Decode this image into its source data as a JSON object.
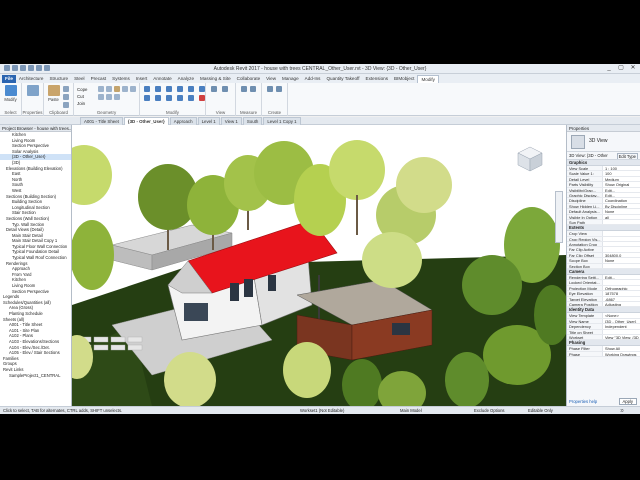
{
  "window": {
    "title": "Autodesk Revit 2017 - house with trees CENTRAL_Other_User.rvt - 3D View: {3D - Other_User}",
    "controls": [
      "_",
      "▢",
      "✕"
    ]
  },
  "ribbon_tabs": [
    "File",
    "Architecture",
    "Structure",
    "Steel",
    "Precast",
    "Systems",
    "Insert",
    "Annotate",
    "Analyze",
    "Massing & Site",
    "Collaborate",
    "View",
    "Manage",
    "Add-Ins",
    "Quantity Takeoff",
    "Extensions",
    "BIMobject",
    "Modify"
  ],
  "active_tab": "Modify",
  "ribbon_panels": {
    "select": {
      "label": "Select",
      "button": "Modify"
    },
    "properties": {
      "label": "Properties"
    },
    "clipboard": {
      "label": "Clipboard",
      "paste": "Paste"
    },
    "geometry": {
      "label": "Geometry",
      "cope": "Cope",
      "cut": "Cut",
      "join": "Join"
    },
    "modify": {
      "label": "Modify"
    },
    "view": {
      "label": "View"
    },
    "measure": {
      "label": "Measure"
    },
    "create": {
      "label": "Create"
    }
  },
  "view_tabs": [
    "A001 - Title Sheet",
    "{3D - Other_User}",
    "Approach",
    "Level 1",
    "View 1",
    "South",
    "Level 1 Copy 1"
  ],
  "active_view_tab": "{3D - Other_User}",
  "project_browser": {
    "title": "Project Browser - house with trees...",
    "items": [
      {
        "label": "Kitchen",
        "indent": 4
      },
      {
        "label": "Living Room",
        "indent": 4
      },
      {
        "label": "Section Perspective",
        "indent": 4
      },
      {
        "label": "Solar Analysis",
        "indent": 4
      },
      {
        "label": "{3D - Other_User}",
        "indent": 4,
        "selected": true
      },
      {
        "label": "{3D}",
        "indent": 4
      },
      {
        "label": "Elevations (Building Elevation)",
        "indent": 2
      },
      {
        "label": "East",
        "indent": 4
      },
      {
        "label": "North",
        "indent": 4
      },
      {
        "label": "South",
        "indent": 4
      },
      {
        "label": "West",
        "indent": 4
      },
      {
        "label": "Sections (Building Section)",
        "indent": 2
      },
      {
        "label": "Building Section",
        "indent": 4
      },
      {
        "label": "Longitudinal Section",
        "indent": 4
      },
      {
        "label": "Stair Section",
        "indent": 4
      },
      {
        "label": "Sections (Wall Section)",
        "indent": 2
      },
      {
        "label": "Typ. Wall Section",
        "indent": 4
      },
      {
        "label": "Detail Views (Detail)",
        "indent": 2
      },
      {
        "label": "Main Stair Detail",
        "indent": 4
      },
      {
        "label": "Main Stair Detail Copy 1",
        "indent": 4
      },
      {
        "label": "Typical Floor Wall Connection",
        "indent": 4
      },
      {
        "label": "Typical Foundation Detail",
        "indent": 4
      },
      {
        "label": "Typical Wall Roof Connection",
        "indent": 4
      },
      {
        "label": "Renderings",
        "indent": 2
      },
      {
        "label": "Approach",
        "indent": 4
      },
      {
        "label": "From Yard",
        "indent": 4
      },
      {
        "label": "Kitchen",
        "indent": 4
      },
      {
        "label": "Living Room",
        "indent": 4
      },
      {
        "label": "Section Perspective",
        "indent": 4
      },
      {
        "label": "Legends",
        "indent": 1
      },
      {
        "label": "Schedules/Quantities (all)",
        "indent": 1
      },
      {
        "label": "Area (Gross)",
        "indent": 3
      },
      {
        "label": "Planting Schedule",
        "indent": 3
      },
      {
        "label": "Sheets (all)",
        "indent": 1
      },
      {
        "label": "A001 - Title Sheet",
        "indent": 3
      },
      {
        "label": "A101 - Site Plan",
        "indent": 3
      },
      {
        "label": "A102 - Plans",
        "indent": 3
      },
      {
        "label": "A103 - Elevations/Sections",
        "indent": 3
      },
      {
        "label": "A104 - Elev./Sec./Det.",
        "indent": 3
      },
      {
        "label": "A105 - Elev./ Stair Sections",
        "indent": 3
      },
      {
        "label": "Families",
        "indent": 1
      },
      {
        "label": "Groups",
        "indent": 1
      },
      {
        "label": "Revit Links",
        "indent": 1
      },
      {
        "label": "SampleProject1_CENTRAL",
        "indent": 3
      }
    ]
  },
  "properties": {
    "title": "Properties",
    "type_name": "3D View",
    "filter": "3D View: {3D - Other",
    "edit_type": "Edit Type",
    "groups": [
      {
        "name": "Graphics",
        "rows": [
          [
            "View Scale",
            "1 : 100"
          ],
          [
            "Scale Value 1:",
            "100"
          ],
          [
            "Detail Level",
            "Medium"
          ],
          [
            "Parts Visibility",
            "Show Original"
          ],
          [
            "Visibility/Grap...",
            "Edit..."
          ],
          [
            "Graphic Display...",
            "Edit..."
          ],
          [
            "Discipline",
            "Coordination"
          ],
          [
            "Show Hidden Li...",
            "By Discipline"
          ],
          [
            "Default Analysis...",
            "None"
          ],
          [
            "Visible In Option",
            "all"
          ],
          [
            "Sun Path",
            ""
          ]
        ]
      },
      {
        "name": "Extents",
        "rows": [
          [
            "Crop View",
            ""
          ],
          [
            "Crop Region Vis...",
            ""
          ],
          [
            "Annotation Crop",
            ""
          ],
          [
            "Far Clip Active",
            ""
          ],
          [
            "Far Clip Offset",
            "304800.0"
          ],
          [
            "Scope Box",
            "None"
          ],
          [
            "Section Box",
            ""
          ]
        ]
      },
      {
        "name": "Camera",
        "rows": [
          [
            "Rendering Setti...",
            "Edit..."
          ],
          [
            "Locked Orientat...",
            ""
          ],
          [
            "Projection Mode",
            "Orthographic"
          ],
          [
            "Eye Elevation",
            "187578"
          ],
          [
            "Target Elevation",
            "-6867"
          ],
          [
            "Camera Position",
            "Adjusting"
          ]
        ]
      },
      {
        "name": "Identity Data",
        "rows": [
          [
            "View Template",
            "<None>"
          ],
          [
            "View Name",
            "{3D - Other_User}"
          ],
          [
            "Dependency",
            "Independent"
          ],
          [
            "Title on Sheet",
            ""
          ],
          [
            "Workset",
            "View \"3D View: {3D -"
          ]
        ]
      },
      {
        "name": "Phasing",
        "rows": [
          [
            "Phase Filter",
            "Show All"
          ],
          [
            "Phase",
            "Working Drawings"
          ]
        ]
      }
    ],
    "help": "Properties help",
    "apply": "Apply"
  },
  "status_bar": {
    "hint": "Click to select, TAB for alternates, CTRL adds, SHIFT unselects.",
    "workset": "Workset1 (Not Editable)",
    "model": "Main Model",
    "exclude_options": "Exclude Options",
    "editable_only": "Editable Only",
    "filter_count": ":0"
  },
  "colors": {
    "roof": "#e8141c",
    "cladding": "#8a3a22",
    "tree_light": "#c8dc6a",
    "tree_dark": "#5f8c2c",
    "ground": "#253e12",
    "file_tab": "#2a64b0"
  }
}
